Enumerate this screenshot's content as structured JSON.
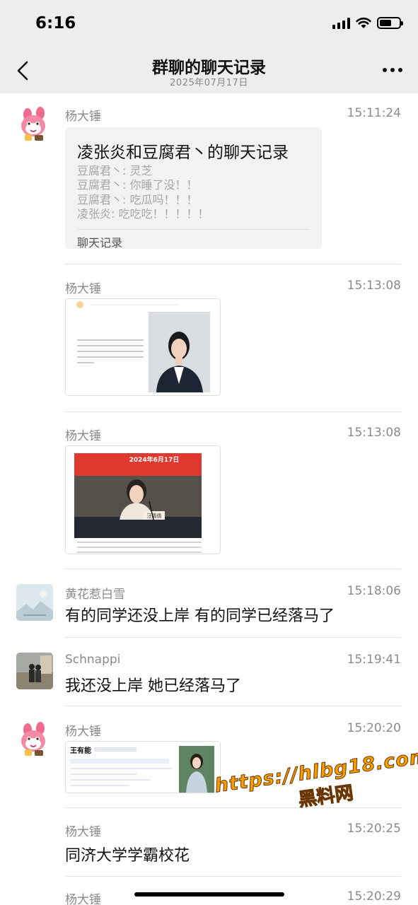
{
  "status": {
    "time": "6:16",
    "battery_level": 0.6
  },
  "nav": {
    "title": "群聊的聊天记录",
    "date": "2025年07月17日"
  },
  "messages": [
    {
      "sender": "杨大锤",
      "time": "15:11:24",
      "record": {
        "title": "凌张炎和豆腐君丶的聊天记录",
        "lines": [
          "豆腐君丶: 灵芝",
          "豆腐君丶: 你睡了没！！",
          "豆腐君丶: 吃瓜吗！！！",
          "凌张炎: 吃吃吃！！！！！"
        ],
        "footer": "聊天记录"
      }
    },
    {
      "sender": "杨大锤",
      "time": "15:13:08"
    },
    {
      "sender": "杨大锤",
      "time": "15:13:08",
      "image_banner": "2024年6月17日",
      "image_nameplate": "汪倩倩"
    },
    {
      "sender": "黄花惹白雪",
      "time": "15:18:06",
      "text": "有的同学还没上岸 有的同学已经落马了"
    },
    {
      "sender": "Schnappi",
      "time": "15:19:41",
      "text": "我还没上岸 她已经落马了"
    },
    {
      "sender": "杨大锤",
      "time": "15:20:20",
      "image_name": "王有能"
    },
    {
      "sender": "杨大锤",
      "time": "15:20:25",
      "text": "同济大学学霸校花"
    },
    {
      "sender": "杨大锤",
      "time": "15:20:29"
    }
  ],
  "watermark": {
    "url": "https://hlbg18.com",
    "label": "黑料网"
  }
}
